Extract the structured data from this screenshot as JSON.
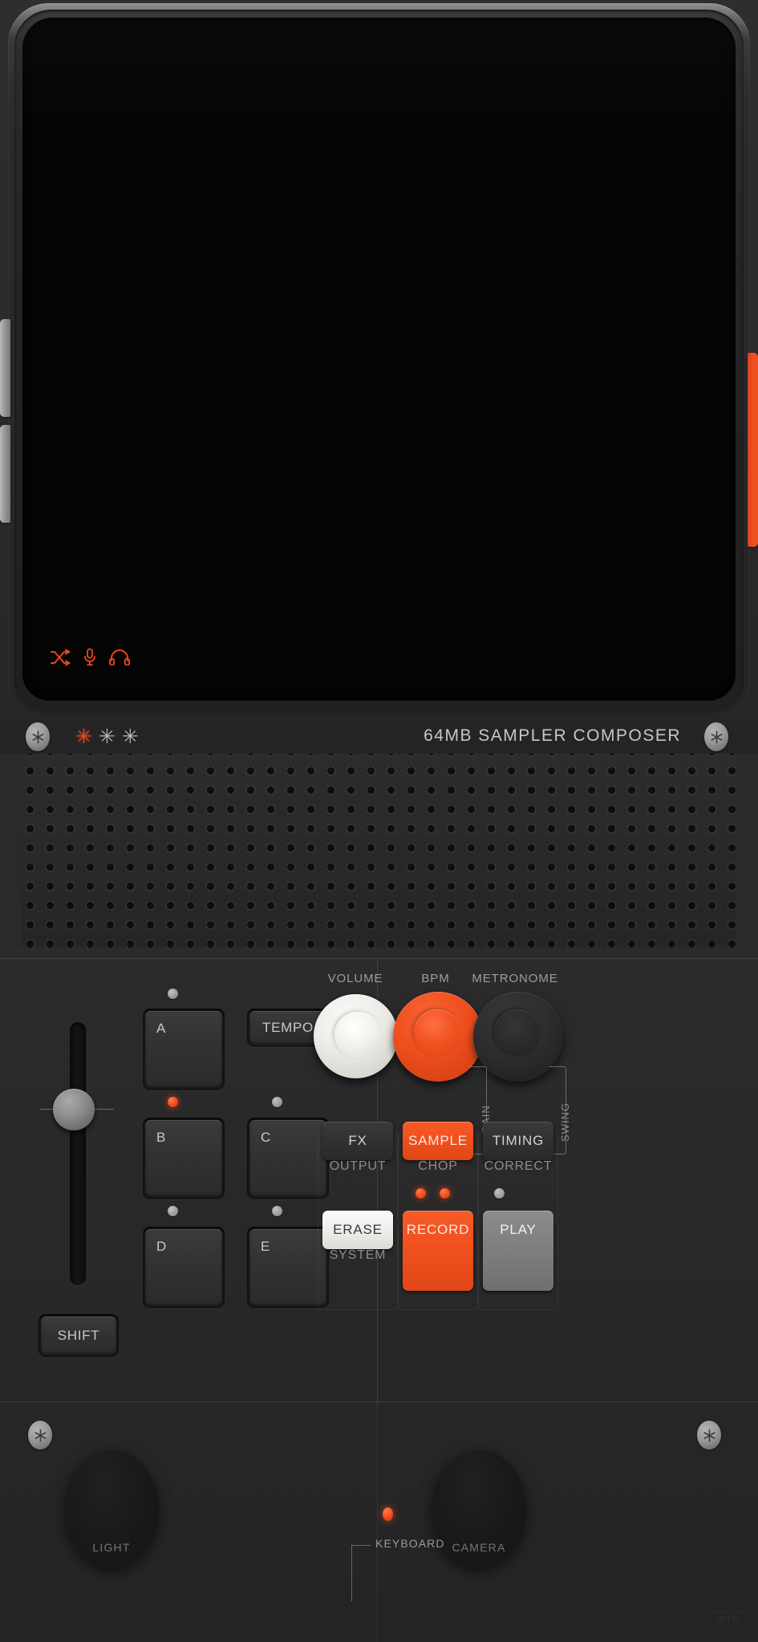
{
  "device": {
    "brand_text": "64MB  SAMPLER  COMPOSER",
    "watermark": "iNTR"
  },
  "screen": {
    "status_icons": [
      {
        "name": "shuffle-icon",
        "label": "shuffle"
      },
      {
        "name": "microphone-icon",
        "label": "microphone"
      },
      {
        "name": "headphones-icon",
        "label": "headphones"
      }
    ]
  },
  "side_buttons": {
    "volume_up": "volume-up",
    "volume_down": "volume-down",
    "power": "power"
  },
  "brand_strip": {
    "leds": [
      {
        "state": "on",
        "glyph": "✳"
      },
      {
        "state": "off",
        "glyph": "✳"
      },
      {
        "state": "off",
        "glyph": "✳"
      }
    ]
  },
  "left_panel": {
    "fader_label": "fader",
    "shift_label": "SHIFT",
    "tempo_label": "TEMPO",
    "pads": [
      {
        "label": "A",
        "led": "grey"
      },
      {
        "label": "B",
        "led": "red"
      },
      {
        "label": "C",
        "led": "grey"
      },
      {
        "label": "D",
        "led": "grey"
      },
      {
        "label": "E",
        "led": "grey"
      }
    ]
  },
  "right_panel": {
    "knobs": [
      {
        "label": "VOLUME",
        "color": "#eeeeea"
      },
      {
        "label": "BPM",
        "color": "#f0501f"
      },
      {
        "label": "METRONOME",
        "color": "#2f2f31"
      }
    ],
    "brackets": [
      {
        "label": "GAIN"
      },
      {
        "label": "SWING"
      }
    ],
    "mode_buttons": [
      {
        "top": "FX",
        "sub": "OUTPUT",
        "style": "dark"
      },
      {
        "top": "SAMPLE",
        "sub": "CHOP",
        "style": "orange"
      },
      {
        "top": "TIMING",
        "sub": "CORRECT",
        "style": "dark"
      }
    ],
    "transport_buttons": [
      {
        "top": "ERASE",
        "sub": "SYSTEM",
        "style": "white"
      },
      {
        "top": "RECORD",
        "sub": "",
        "style": "orange"
      },
      {
        "top": "PLAY",
        "sub": "",
        "style": "grey"
      }
    ],
    "transport_leds": [
      {
        "state": "red"
      },
      {
        "state": "red"
      },
      {
        "state": "grey"
      }
    ]
  },
  "bottom_panel": {
    "light_label": "LIGHT",
    "camera_label": "CAMERA",
    "keyboard_label": "KEYBOARD"
  },
  "colors": {
    "accent_orange": "#f0501f",
    "body_dark": "#2a2a2c",
    "screen_black": "#040404",
    "led_grey": "#9a9a9a"
  }
}
